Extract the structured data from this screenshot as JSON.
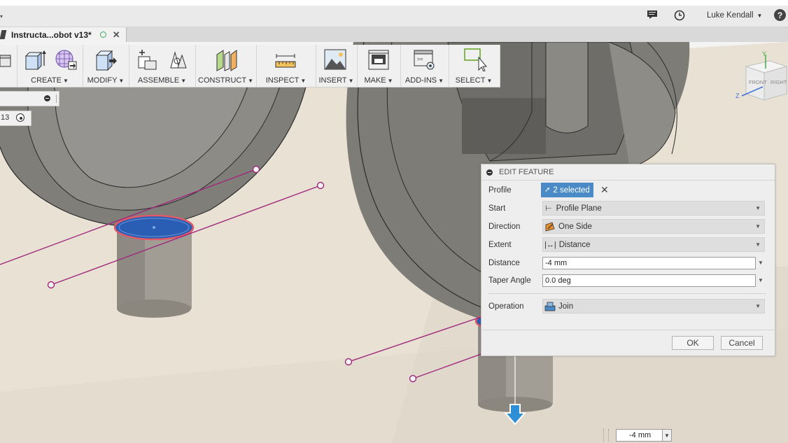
{
  "header": {
    "user_name": "Luke Kendall",
    "user_caret": "▼",
    "help_label": "?"
  },
  "document_tab": {
    "title": "Instructa...obot v13*"
  },
  "toolbar": {
    "groups": [
      {
        "label": "CREATE",
        "caret": "▼"
      },
      {
        "label": "MODIFY",
        "caret": "▼"
      },
      {
        "label": "ASSEMBLE",
        "caret": "▼"
      },
      {
        "label": "CONSTRUCT",
        "caret": "▼"
      },
      {
        "label": "INSPECT",
        "caret": "▼"
      },
      {
        "label": "INSERT",
        "caret": "▼"
      },
      {
        "label": "MAKE",
        "caret": "▼"
      },
      {
        "label": "ADD-INS",
        "caret": "▼"
      },
      {
        "label": "SELECT",
        "caret": "▼"
      }
    ]
  },
  "browser": {
    "row2_text": "13"
  },
  "viewcube": {
    "front_label": "FRONT",
    "right_label": "RIGHT",
    "axis_y": "Y",
    "axis_z": "Z"
  },
  "edit_feature": {
    "title": "EDIT FEATURE",
    "profile": {
      "label": "Profile",
      "value": "2 selected"
    },
    "start": {
      "label": "Start",
      "value": "Profile Plane"
    },
    "direction": {
      "label": "Direction",
      "value": "One Side"
    },
    "extent": {
      "label": "Extent",
      "value": "Distance"
    },
    "distance": {
      "label": "Distance",
      "value": "-4 mm"
    },
    "taper_angle": {
      "label": "Taper Angle",
      "value": "0.0 deg"
    },
    "operation": {
      "label": "Operation",
      "value": "Join"
    },
    "ok_label": "OK",
    "cancel_label": "Cancel"
  },
  "canvas_input": {
    "value": "-4 mm"
  },
  "colors": {
    "accent_blue": "#4a8bc7",
    "sketch_line": "#a0287c",
    "profile_fill": "#2a5db4",
    "arrow_blue": "#2e8fd6"
  }
}
